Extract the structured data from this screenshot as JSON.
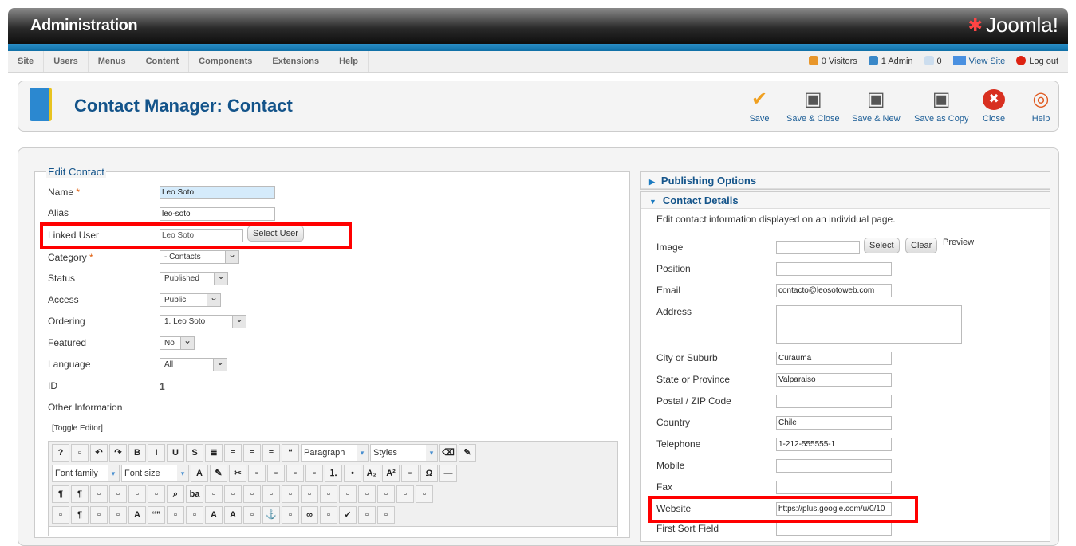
{
  "header": {
    "title": "Administration",
    "logo_text": "Joomla!"
  },
  "menu": [
    "Site",
    "Users",
    "Menus",
    "Content",
    "Components",
    "Extensions",
    "Help"
  ],
  "status": {
    "visitors": "0 Visitors",
    "admins": "1 Admin",
    "messages": "0",
    "view_site": "View Site",
    "logout": "Log out"
  },
  "page_title": "Contact Manager: Contact",
  "toolbar": [
    {
      "label": "Save",
      "icon": "check-icon"
    },
    {
      "label": "Save & Close",
      "icon": "floppy-icon"
    },
    {
      "label": "Save & New",
      "icon": "floppy-plus-icon"
    },
    {
      "label": "Save as Copy",
      "icon": "floppy-copy-icon"
    },
    {
      "label": "Close",
      "icon": "close-icon"
    },
    {
      "label": "Help",
      "icon": "lifebuoy-icon"
    }
  ],
  "edit": {
    "legend": "Edit Contact",
    "name_label": "Name",
    "name": "Leo Soto",
    "alias_label": "Alias",
    "alias": "leo-soto",
    "linked_user_label": "Linked User",
    "linked_user": "Leo Soto",
    "select_user": "Select User",
    "category_label": "Category",
    "category": "- Contacts",
    "status_label": "Status",
    "status": "Published",
    "access_label": "Access",
    "access": "Public",
    "ordering_label": "Ordering",
    "ordering": "1. Leo Soto",
    "featured_label": "Featured",
    "featured": "No",
    "language_label": "Language",
    "language": "All",
    "id_label": "ID",
    "id": "1",
    "other_label": "Other Information",
    "toggle_editor": "[Toggle Editor]",
    "required": "*"
  },
  "editor": {
    "paragraph": "Paragraph",
    "styles": "Styles",
    "font_family": "Font family",
    "font_size": "Font size",
    "row1": [
      "help-icon",
      "new-document-icon",
      "undo-icon",
      "redo-icon",
      "bold-icon",
      "italic-icon",
      "underline-icon",
      "strikethrough-icon",
      "justify-icon",
      "align-center-icon",
      "align-left-icon",
      "align-right-icon",
      "blockquote-icon"
    ],
    "row1b": [
      "eraser-icon",
      "brush-icon"
    ],
    "row2": [
      "text-color-icon",
      "highlight-icon",
      "cut-icon",
      "copy-icon",
      "paste-icon",
      "indent-icon",
      "outdent-icon",
      "ordered-list-icon",
      "bullet-list-icon",
      "subscript-icon",
      "superscript-icon",
      "font-style-icon",
      "omega-icon",
      "horizontal-rule-icon"
    ],
    "row3": [
      "ltr-icon",
      "rtl-icon",
      "fullscreen-icon",
      "preview-icon",
      "code-icon",
      "print-icon",
      "find-icon",
      "replace-icon",
      "table-icon",
      "delete-table-icon",
      "row-before-icon",
      "row-after-icon",
      "insert-row-before-icon",
      "insert-row-after-icon",
      "delete-row-icon",
      "col-before-icon",
      "col-after-icon",
      "delete-col-icon",
      "merge-cells-icon",
      "split-cells-icon"
    ],
    "row4": [
      "visual-aid-icon",
      "show-blocks-icon",
      "template-icon",
      "pagebreak-icon",
      "styles-icon",
      "cite-icon",
      "abbr-icon",
      "acronym-icon",
      "del-icon",
      "ins-icon",
      "attributes-icon",
      "anchor-icon",
      "unlink-icon",
      "link-icon",
      "image-icon",
      "spellcheck-icon",
      "layer-icon",
      "layer-forward-icon"
    ]
  },
  "glyphs": {
    "help-icon": "?",
    "bold-icon": "B",
    "italic-icon": "I",
    "underline-icon": "U",
    "strikethrough-icon": "S",
    "justify-icon": "≣",
    "align-center-icon": "≡",
    "align-left-icon": "≡",
    "align-right-icon": "≡",
    "blockquote-icon": "“",
    "eraser-icon": "⌫",
    "brush-icon": "✎",
    "text-color-icon": "A",
    "highlight-icon": "✎",
    "cut-icon": "✂",
    "ordered-list-icon": "⒈",
    "bullet-list-icon": "•",
    "subscript-icon": "A₂",
    "superscript-icon": "A²",
    "omega-icon": "Ω",
    "horizontal-rule-icon": "—",
    "ltr-icon": "¶",
    "rtl-icon": "¶",
    "find-icon": "⌕",
    "replace-icon": "ba",
    "show-blocks-icon": "¶",
    "styles-icon": "A",
    "cite-icon": "“”",
    "del-icon": "A",
    "ins-icon": "A",
    "anchor-icon": "⚓",
    "link-icon": "∞",
    "spellcheck-icon": "✓",
    "undo-icon": "↶",
    "redo-icon": "↷"
  },
  "details": {
    "publishing": "Publishing Options",
    "contact_details": "Contact Details",
    "description": "Edit contact information displayed on an individual page.",
    "image_label": "Image",
    "select": "Select",
    "clear": "Clear",
    "preview": "Preview",
    "fields": [
      {
        "label": "Position",
        "value": ""
      },
      {
        "label": "Email",
        "value": "contacto@leosotoweb.com"
      },
      {
        "label": "Address",
        "value": ""
      },
      {
        "label": "City or Suburb",
        "value": "Curauma"
      },
      {
        "label": "State or Province",
        "value": "Valparaiso"
      },
      {
        "label": "Postal / ZIP Code",
        "value": ""
      },
      {
        "label": "Country",
        "value": "Chile"
      },
      {
        "label": "Telephone",
        "value": "1-212-555555-1"
      },
      {
        "label": "Mobile",
        "value": ""
      },
      {
        "label": "Fax",
        "value": ""
      },
      {
        "label": "Website",
        "value": "https://plus.google.com/u/0/10"
      },
      {
        "label": "First Sort Field",
        "value": ""
      }
    ]
  },
  "colors": {
    "accent": "#14548a",
    "highlight": "#ff0000",
    "header_stripe": "#1b7ec0"
  }
}
